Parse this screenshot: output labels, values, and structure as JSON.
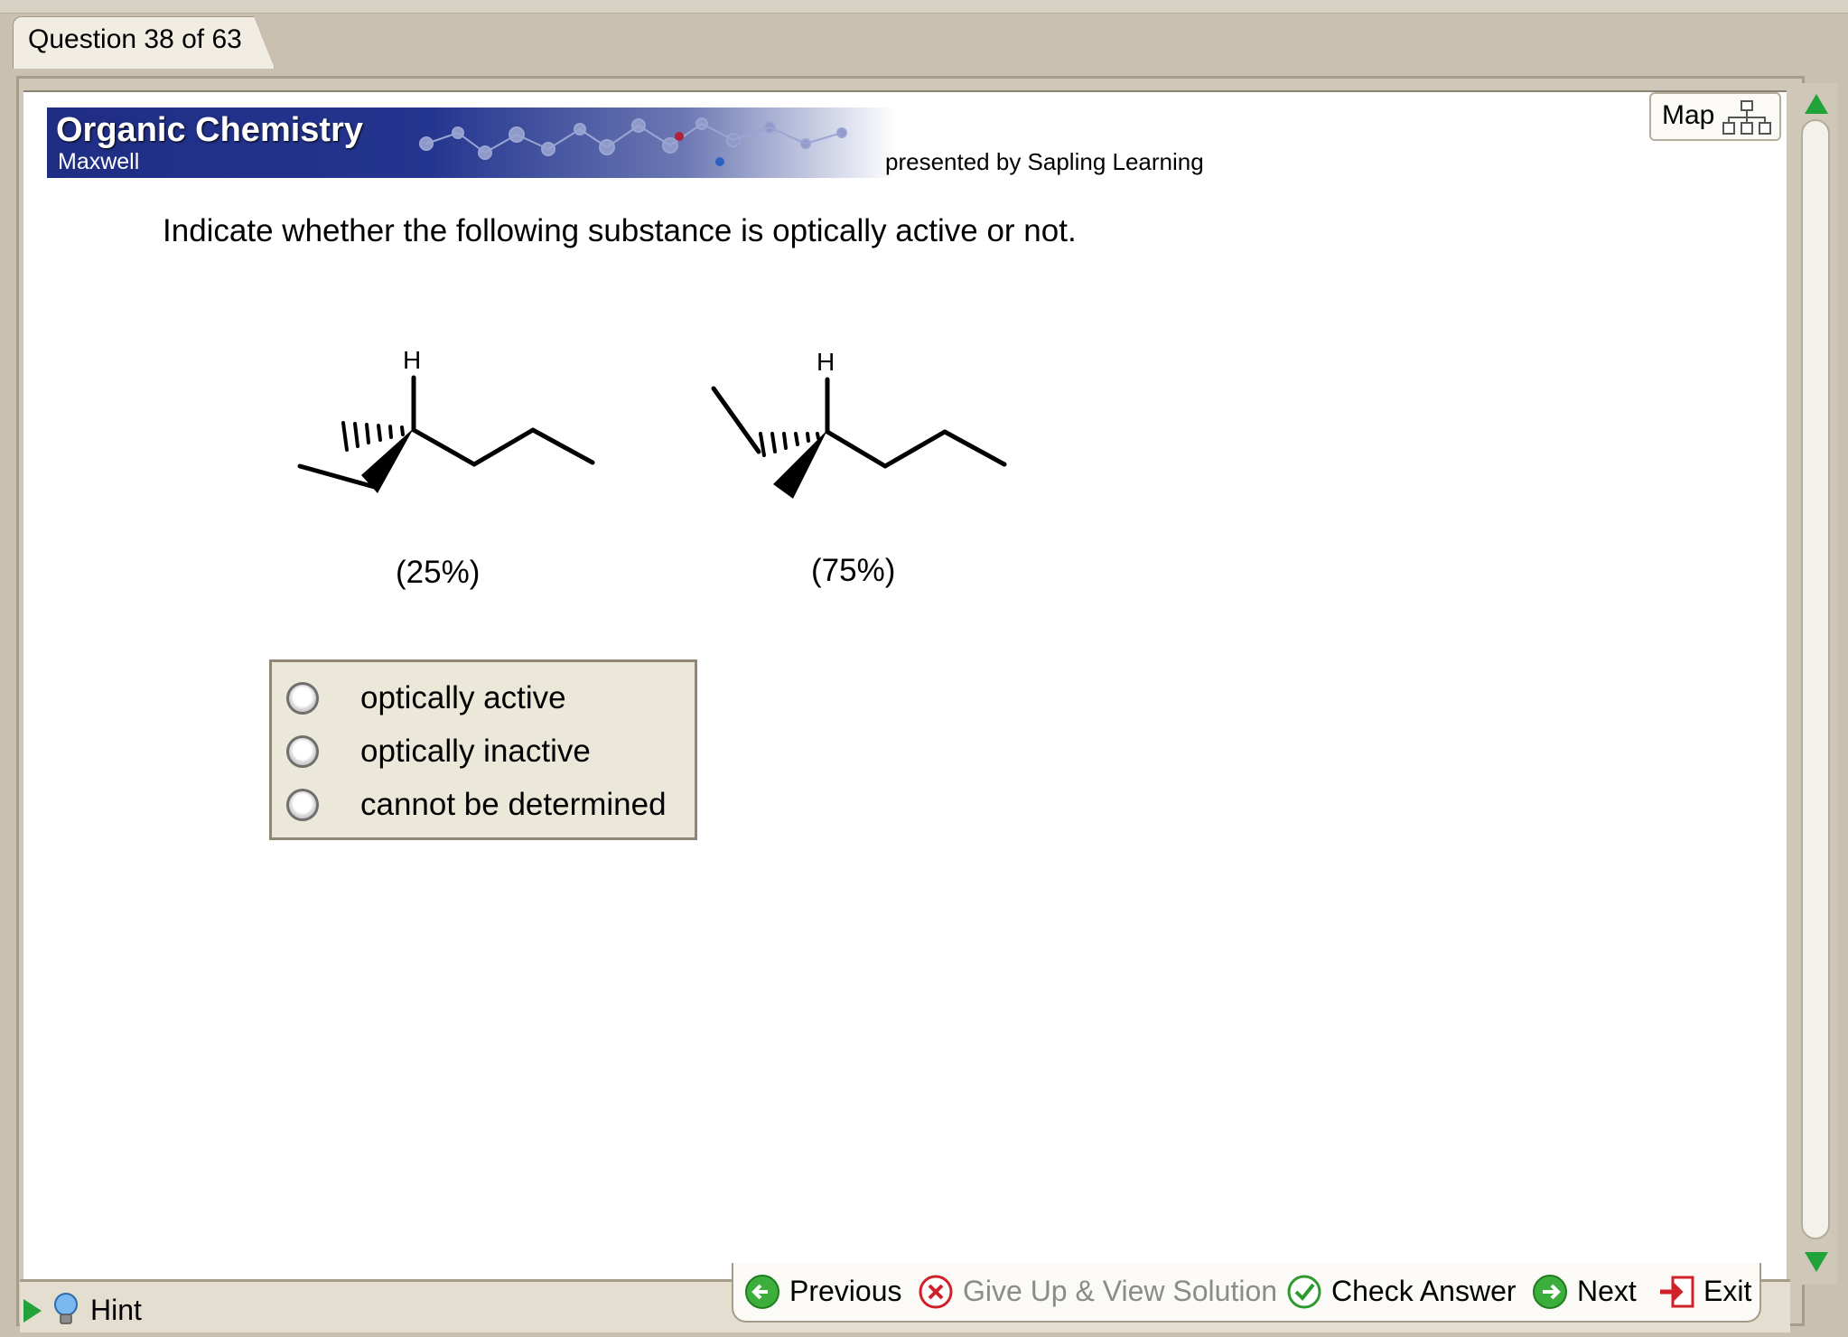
{
  "header": {
    "question_counter": "Question 38 of 63",
    "course_title": "Organic Chemistry",
    "course_author": "Maxwell",
    "presented_by": "presented by Sapling Learning",
    "map_label": "Map"
  },
  "question": {
    "prompt": "Indicate whether the following substance is optically active or not.",
    "structures": [
      {
        "atom_label": "H",
        "percent": "(25%)"
      },
      {
        "atom_label": "H",
        "percent": "(75%)"
      }
    ]
  },
  "answers": {
    "options": [
      {
        "label": "optically active",
        "selected": false
      },
      {
        "label": "optically inactive",
        "selected": false
      },
      {
        "label": "cannot be determined",
        "selected": false
      }
    ]
  },
  "footer": {
    "hint_label": "Hint",
    "previous_label": "Previous",
    "give_up_label": "Give Up & View Solution",
    "check_label": "Check Answer",
    "next_label": "Next",
    "exit_label": "Exit"
  },
  "colors": {
    "accent_green": "#22a33a",
    "banner_blue": "#1f2d84",
    "exit_red": "#d0202a",
    "disabled_gray": "#8b8b8b"
  }
}
